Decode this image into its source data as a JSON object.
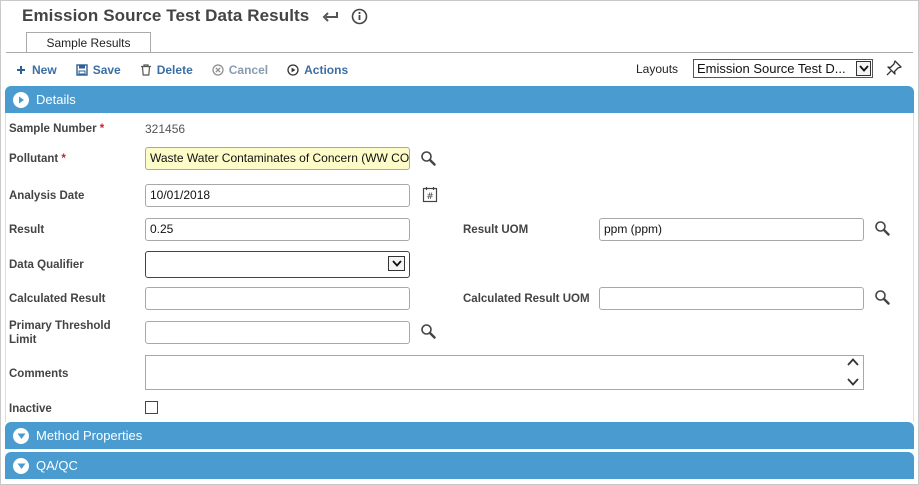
{
  "title": "Emission Source Test Data Results",
  "tabs": [
    {
      "label": "Sample Results"
    }
  ],
  "toolbar": {
    "new": "New",
    "save": "Save",
    "delete": "Delete",
    "cancel": "Cancel",
    "actions": "Actions",
    "layouts_label": "Layouts",
    "layouts_value": "Emission Source Test D..."
  },
  "sections": {
    "details": "Details",
    "method_properties": "Method Properties",
    "qaqc": "QA/QC"
  },
  "fields": {
    "sample_number": {
      "label": "Sample Number",
      "required": "*",
      "value": "321456"
    },
    "pollutant": {
      "label": "Pollutant",
      "required": "*",
      "value": "Waste Water Contaminates of Concern (WW COC)"
    },
    "analysis_date": {
      "label": "Analysis Date",
      "value": "10/01/2018"
    },
    "result": {
      "label": "Result",
      "value": "0.25"
    },
    "result_uom": {
      "label": "Result UOM",
      "value": "ppm (ppm)"
    },
    "data_qualifier": {
      "label": "Data Qualifier",
      "value": ""
    },
    "calculated_result": {
      "label": "Calculated Result",
      "value": ""
    },
    "calculated_result_uom": {
      "label": "Calculated Result UOM",
      "value": ""
    },
    "primary_threshold_limit": {
      "label_line1": "Primary Threshold",
      "label_line2": "Limit",
      "value": ""
    },
    "comments": {
      "label": "Comments",
      "value": ""
    },
    "inactive": {
      "label": "Inactive",
      "checked": false
    }
  },
  "colors": {
    "section_bar": "#4a9bd0",
    "toolbar_link": "#3b6ea5",
    "required": "#d0202e",
    "lookup_field_bg": "#fdfbc8"
  }
}
